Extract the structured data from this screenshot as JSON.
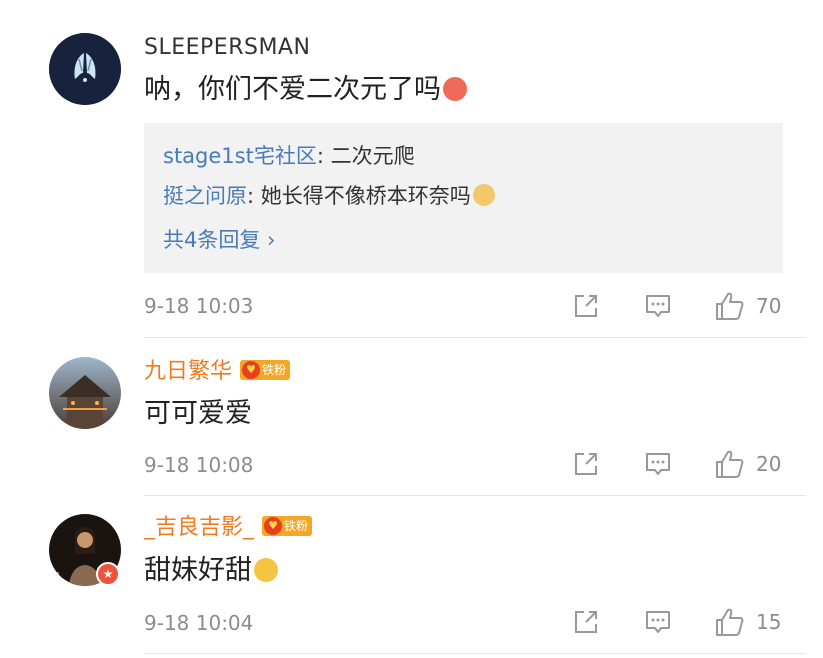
{
  "comments": [
    {
      "username": "SLEEPERSMAN",
      "text": "呐，你们不爱二次元了吗",
      "replies": [
        {
          "author": "stage1st宅社区",
          "text": ": 二次元爬"
        },
        {
          "author": "挺之问原",
          "text": ": 她长得不像桥本环奈吗"
        }
      ],
      "replies_more": "共4条回复 ›",
      "time": "9-18 10:03",
      "likes": "70"
    },
    {
      "username": "九日繁华",
      "badge": "铁粉",
      "text": "可可爱爱",
      "time": "9-18 10:08",
      "likes": "20"
    },
    {
      "username": "_吉良吉影_",
      "badge": "铁粉",
      "text": "甜妹好甜",
      "time": "9-18 10:04",
      "likes": "15"
    }
  ],
  "icons": {
    "share": "share-icon",
    "comment": "comment-icon",
    "like": "thumbs-up-icon"
  },
  "colors": {
    "link": "#4b7ab8",
    "username_highlight": "#f27a1f",
    "badge": "#f5a623",
    "meta": "#8c8c8c",
    "reply_bg": "#f2f2f2"
  }
}
